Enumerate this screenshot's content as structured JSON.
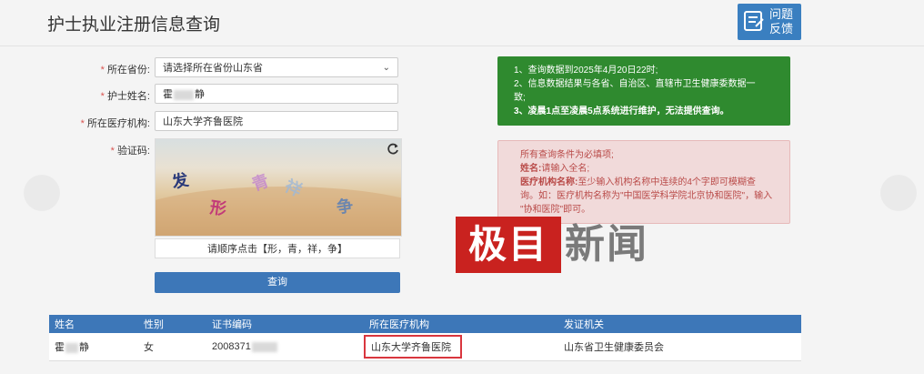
{
  "header": {
    "title": "护士执业注册信息查询",
    "feedback_label": [
      "问题",
      "反馈"
    ]
  },
  "form": {
    "province_label": "所在省份:",
    "province_value": "请选择所在省份山东省",
    "name_label": "护士姓名:",
    "name_value_first": "霍",
    "name_value_last": "静",
    "institution_label": "所在医疗机构:",
    "institution_value": "山东大学齐鲁医院",
    "captcha_label": "验证码:",
    "captcha_chars": [
      "发",
      "形",
      "青",
      "祥",
      "争"
    ],
    "captcha_hint": "请顺序点击【形，青，祥，争】",
    "submit_label": "查询"
  },
  "notice_green": [
    "1、查询数据到2025年4月20日22时;",
    "2、信息数据结果与各省、自治区、直辖市卫生健康委数据一",
    "致;",
    "3、凌晨1点至凌晨5点系统进行维护，无法提供查询。"
  ],
  "notice_red": {
    "line1": "所有查询条件为必填项;",
    "name_key": "姓名:",
    "name_text": "请输入全名;",
    "inst_key": "医疗机构名称:",
    "inst_text": "至少输入机构名称中连续的4个字即可模糊查",
    "inst_text2": "询。如：医疗机构名称为\"中国医学科学院北京协和医院\"，输入",
    "inst_text3": "\"协和医院\"即可。"
  },
  "watermark": {
    "red": "极目",
    "gray": "新闻"
  },
  "table": {
    "headers": [
      "姓名",
      "性别",
      "证书编码",
      "所在医疗机构",
      "发证机关"
    ],
    "row": {
      "name_first": "霍",
      "name_last": "静",
      "gender": "女",
      "cert_prefix": "2008371",
      "institution": "山东大学齐鲁医院",
      "issuer": "山东省卫生健康委员会"
    }
  },
  "colors": {
    "primary": "#3d77b8",
    "green": "#2f8a2f",
    "red_text": "#b94a48",
    "highlight": "#d9363e"
  }
}
